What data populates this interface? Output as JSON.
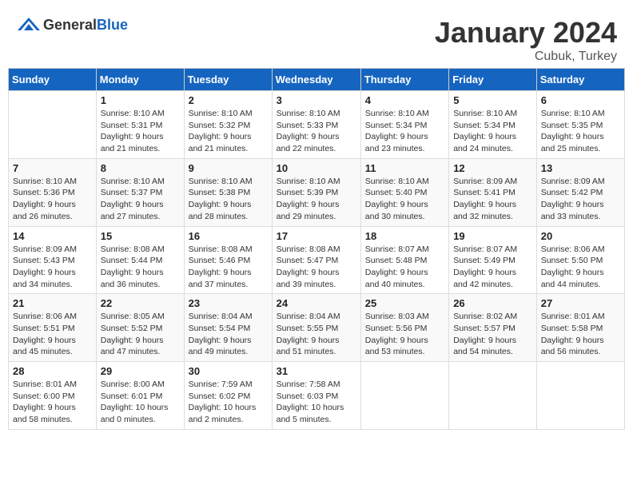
{
  "logo": {
    "general": "General",
    "blue": "Blue"
  },
  "header": {
    "month": "January 2024",
    "location": "Cubuk, Turkey"
  },
  "weekdays": [
    "Sunday",
    "Monday",
    "Tuesday",
    "Wednesday",
    "Thursday",
    "Friday",
    "Saturday"
  ],
  "weeks": [
    [
      {
        "day": "",
        "info": ""
      },
      {
        "day": "1",
        "info": "Sunrise: 8:10 AM\nSunset: 5:31 PM\nDaylight: 9 hours\nand 21 minutes."
      },
      {
        "day": "2",
        "info": "Sunrise: 8:10 AM\nSunset: 5:32 PM\nDaylight: 9 hours\nand 21 minutes."
      },
      {
        "day": "3",
        "info": "Sunrise: 8:10 AM\nSunset: 5:33 PM\nDaylight: 9 hours\nand 22 minutes."
      },
      {
        "day": "4",
        "info": "Sunrise: 8:10 AM\nSunset: 5:34 PM\nDaylight: 9 hours\nand 23 minutes."
      },
      {
        "day": "5",
        "info": "Sunrise: 8:10 AM\nSunset: 5:34 PM\nDaylight: 9 hours\nand 24 minutes."
      },
      {
        "day": "6",
        "info": "Sunrise: 8:10 AM\nSunset: 5:35 PM\nDaylight: 9 hours\nand 25 minutes."
      }
    ],
    [
      {
        "day": "7",
        "info": "Sunrise: 8:10 AM\nSunset: 5:36 PM\nDaylight: 9 hours\nand 26 minutes."
      },
      {
        "day": "8",
        "info": "Sunrise: 8:10 AM\nSunset: 5:37 PM\nDaylight: 9 hours\nand 27 minutes."
      },
      {
        "day": "9",
        "info": "Sunrise: 8:10 AM\nSunset: 5:38 PM\nDaylight: 9 hours\nand 28 minutes."
      },
      {
        "day": "10",
        "info": "Sunrise: 8:10 AM\nSunset: 5:39 PM\nDaylight: 9 hours\nand 29 minutes."
      },
      {
        "day": "11",
        "info": "Sunrise: 8:10 AM\nSunset: 5:40 PM\nDaylight: 9 hours\nand 30 minutes."
      },
      {
        "day": "12",
        "info": "Sunrise: 8:09 AM\nSunset: 5:41 PM\nDaylight: 9 hours\nand 32 minutes."
      },
      {
        "day": "13",
        "info": "Sunrise: 8:09 AM\nSunset: 5:42 PM\nDaylight: 9 hours\nand 33 minutes."
      }
    ],
    [
      {
        "day": "14",
        "info": "Sunrise: 8:09 AM\nSunset: 5:43 PM\nDaylight: 9 hours\nand 34 minutes."
      },
      {
        "day": "15",
        "info": "Sunrise: 8:08 AM\nSunset: 5:44 PM\nDaylight: 9 hours\nand 36 minutes."
      },
      {
        "day": "16",
        "info": "Sunrise: 8:08 AM\nSunset: 5:46 PM\nDaylight: 9 hours\nand 37 minutes."
      },
      {
        "day": "17",
        "info": "Sunrise: 8:08 AM\nSunset: 5:47 PM\nDaylight: 9 hours\nand 39 minutes."
      },
      {
        "day": "18",
        "info": "Sunrise: 8:07 AM\nSunset: 5:48 PM\nDaylight: 9 hours\nand 40 minutes."
      },
      {
        "day": "19",
        "info": "Sunrise: 8:07 AM\nSunset: 5:49 PM\nDaylight: 9 hours\nand 42 minutes."
      },
      {
        "day": "20",
        "info": "Sunrise: 8:06 AM\nSunset: 5:50 PM\nDaylight: 9 hours\nand 44 minutes."
      }
    ],
    [
      {
        "day": "21",
        "info": "Sunrise: 8:06 AM\nSunset: 5:51 PM\nDaylight: 9 hours\nand 45 minutes."
      },
      {
        "day": "22",
        "info": "Sunrise: 8:05 AM\nSunset: 5:52 PM\nDaylight: 9 hours\nand 47 minutes."
      },
      {
        "day": "23",
        "info": "Sunrise: 8:04 AM\nSunset: 5:54 PM\nDaylight: 9 hours\nand 49 minutes."
      },
      {
        "day": "24",
        "info": "Sunrise: 8:04 AM\nSunset: 5:55 PM\nDaylight: 9 hours\nand 51 minutes."
      },
      {
        "day": "25",
        "info": "Sunrise: 8:03 AM\nSunset: 5:56 PM\nDaylight: 9 hours\nand 53 minutes."
      },
      {
        "day": "26",
        "info": "Sunrise: 8:02 AM\nSunset: 5:57 PM\nDaylight: 9 hours\nand 54 minutes."
      },
      {
        "day": "27",
        "info": "Sunrise: 8:01 AM\nSunset: 5:58 PM\nDaylight: 9 hours\nand 56 minutes."
      }
    ],
    [
      {
        "day": "28",
        "info": "Sunrise: 8:01 AM\nSunset: 6:00 PM\nDaylight: 9 hours\nand 58 minutes."
      },
      {
        "day": "29",
        "info": "Sunrise: 8:00 AM\nSunset: 6:01 PM\nDaylight: 10 hours\nand 0 minutes."
      },
      {
        "day": "30",
        "info": "Sunrise: 7:59 AM\nSunset: 6:02 PM\nDaylight: 10 hours\nand 2 minutes."
      },
      {
        "day": "31",
        "info": "Sunrise: 7:58 AM\nSunset: 6:03 PM\nDaylight: 10 hours\nand 5 minutes."
      },
      {
        "day": "",
        "info": ""
      },
      {
        "day": "",
        "info": ""
      },
      {
        "day": "",
        "info": ""
      }
    ]
  ]
}
